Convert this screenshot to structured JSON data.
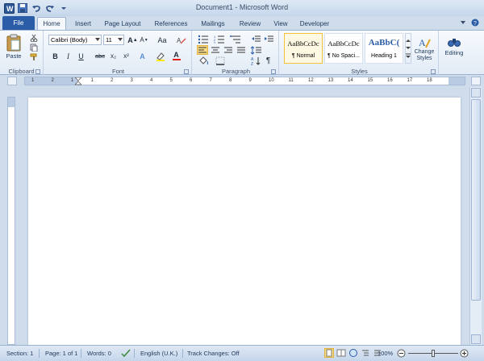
{
  "titlebar": {
    "title": "Document1 - Microsoft Word"
  },
  "tabs": {
    "file": "File",
    "items": [
      "Home",
      "Insert",
      "Page Layout",
      "References",
      "Mailings",
      "Review",
      "View",
      "Developer"
    ],
    "active": "Home"
  },
  "ribbon": {
    "clipboard": {
      "label": "Clipboard",
      "paste": "Paste"
    },
    "font": {
      "label": "Font",
      "font_name": "Calibri (Body)",
      "font_size": "11",
      "bold": "B",
      "italic": "I",
      "underline": "U",
      "strike": "abc",
      "subscript": "x₂",
      "superscript": "x²",
      "grow": "A",
      "shrink": "A",
      "change_case": "Aa",
      "effects": "A",
      "color": "A"
    },
    "paragraph": {
      "label": "Paragraph",
      "show_marks": "¶"
    },
    "styles": {
      "label": "Styles",
      "items": [
        {
          "sample": "AaBbCcDc",
          "name": "¶ Normal"
        },
        {
          "sample": "AaBbCcDc",
          "name": "¶ No Spaci..."
        },
        {
          "sample": "AaBbC(",
          "name": "Heading 1"
        }
      ],
      "change_styles": "Change Styles"
    },
    "editing": {
      "label": "Editing"
    }
  },
  "ruler": {
    "numbers": [
      "1",
      "2",
      "1",
      "1",
      "2",
      "3",
      "4",
      "5",
      "6",
      "7",
      "8",
      "9",
      "10",
      "11",
      "12",
      "13",
      "14",
      "15",
      "16",
      "17",
      "18"
    ]
  },
  "status": {
    "section": "Section: 1",
    "page": "Page: 1 of 1",
    "words": "Words: 0",
    "language": "English (U.K.)",
    "track_changes": "Track Changes: Off",
    "zoom": "100%"
  },
  "colors": {
    "file_tab": "#2a5ca8",
    "ribbon_bg": "#e2ebf6",
    "frame": "#cfdcec",
    "style_selected": "#f4c23b",
    "highlight_yellow": "#ffe600",
    "font_color_red": "#e0201b"
  }
}
